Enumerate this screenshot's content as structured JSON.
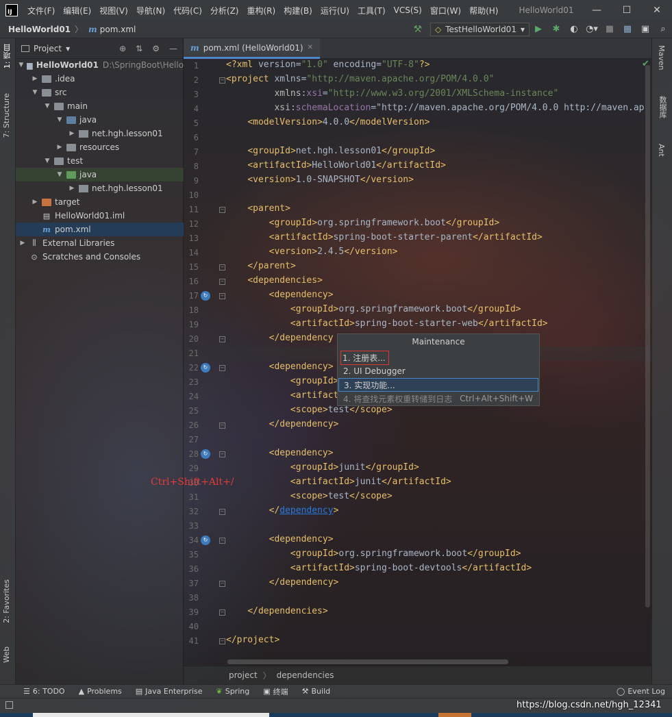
{
  "menu": {
    "logo": "IJ",
    "items": [
      "文件(F)",
      "编辑(E)",
      "视图(V)",
      "导航(N)",
      "代码(C)",
      "分析(Z)",
      "重构(R)",
      "构建(B)",
      "运行(U)",
      "工具(T)",
      "VCS(S)",
      "窗口(W)",
      "帮助(H)"
    ],
    "window_title": "HelloWorld01"
  },
  "navbar": {
    "project": "HelloWorld01",
    "file": "pom.xml",
    "run_config": "TestHelloWorld01"
  },
  "left_tabs": [
    "1: 项目",
    "7: Structure",
    "2: Favorites",
    "Web"
  ],
  "right_tabs": [
    "Maven",
    "数据库",
    "Ant"
  ],
  "project_panel": {
    "title": "Project",
    "tree": [
      {
        "label": "HelloWorld01",
        "extra": "D:\\SpringBoot\\Hello",
        "depth": 0,
        "arrow": "▼",
        "icon": "module"
      },
      {
        "label": ".idea",
        "depth": 1,
        "arrow": "▶",
        "icon": "grey"
      },
      {
        "label": "src",
        "depth": 1,
        "arrow": "▼",
        "icon": "grey"
      },
      {
        "label": "main",
        "depth": 2,
        "arrow": "▼",
        "icon": "grey"
      },
      {
        "label": "java",
        "depth": 3,
        "arrow": "▼",
        "icon": "blue"
      },
      {
        "label": "net.hgh.lesson01",
        "depth": 4,
        "arrow": "▶",
        "icon": "pkg"
      },
      {
        "label": "resources",
        "depth": 3,
        "arrow": "▶",
        "icon": "grey"
      },
      {
        "label": "test",
        "depth": 2,
        "arrow": "▼",
        "icon": "grey"
      },
      {
        "label": "java",
        "depth": 3,
        "arrow": "▼",
        "icon": "green"
      },
      {
        "label": "net.hgh.lesson01",
        "depth": 4,
        "arrow": "▶",
        "icon": "pkg"
      },
      {
        "label": "target",
        "depth": 1,
        "arrow": "▶",
        "icon": "orange"
      },
      {
        "label": "HelloWorld01.iml",
        "depth": 1,
        "arrow": "",
        "icon": "iml"
      },
      {
        "label": "pom.xml",
        "depth": 1,
        "arrow": "",
        "icon": "maven"
      },
      {
        "label": "External Libraries",
        "depth": 0,
        "arrow": "▶",
        "icon": "lib"
      },
      {
        "label": "Scratches and Consoles",
        "depth": 0,
        "arrow": "",
        "icon": "scratch"
      }
    ]
  },
  "editor": {
    "tab_label": "pom.xml (HelloWorld01)",
    "lines": [
      "<?xml version=\"1.0\" encoding=\"UTF-8\"?>",
      "<project xmlns=\"http://maven.apache.org/POM/4.0.0\"",
      "         xmlns:xsi=\"http://www.w3.org/2001/XMLSchema-instance\"",
      "         xsi:schemaLocation=\"http://maven.apache.org/POM/4.0.0 http://maven.ap",
      "    <modelVersion>4.0.0</modelVersion>",
      "",
      "    <groupId>net.hgh.lesson01</groupId>",
      "    <artifactId>HelloWorld01</artifactId>",
      "    <version>1.0-SNAPSHOT</version>",
      "",
      "    <parent>",
      "        <groupId>org.springframework.boot</groupId>",
      "        <artifactId>spring-boot-starter-parent</artifactId>",
      "        <version>2.4.5</version>",
      "    </parent>",
      "    <dependencies>",
      "        <dependency>",
      "            <groupId>org.springframework.boot</groupId>",
      "            <artifactId>spring-boot-starter-web</artifactId>",
      "        </dependency>",
      "",
      "        <dependency>",
      "            <groupId>",
      "            <artifact",
      "            <scope>test</scope>",
      "        </dependency>",
      "",
      "        <dependency>",
      "            <groupId>junit</groupId>",
      "            <artifactId>junit</artifactId>",
      "            <scope>test</scope>",
      "        </dependency>",
      "",
      "        <dependency>",
      "            <groupId>org.springframework.boot</groupId>",
      "            <artifactId>spring-boot-devtools</artifactId>",
      "        </dependency>",
      "",
      "    </dependencies>",
      "",
      "</project>"
    ],
    "line23_tail": "tId>",
    "line20_visible": "        </dependency"
  },
  "breadcrumb": [
    "project",
    "dependencies"
  ],
  "popup": {
    "title": "Maintenance",
    "items": [
      {
        "label": "1. 注册表...",
        "shortcut": ""
      },
      {
        "label": "2. UI Debugger",
        "shortcut": ""
      },
      {
        "label": "3. 实现功能...",
        "shortcut": ""
      },
      {
        "label": "4. 将查找元素权重转储到日志",
        "shortcut": "Ctrl+Alt+Shift+W"
      }
    ]
  },
  "annotation": "Ctrl+Shift+Alt+/",
  "bottom_tabs": [
    "6: TODO",
    "Problems",
    "Java Enterprise",
    "Spring",
    "终端",
    "Build"
  ],
  "event_log": "Event Log",
  "watermark": "https://blog.csdn.net/hgh_12341"
}
